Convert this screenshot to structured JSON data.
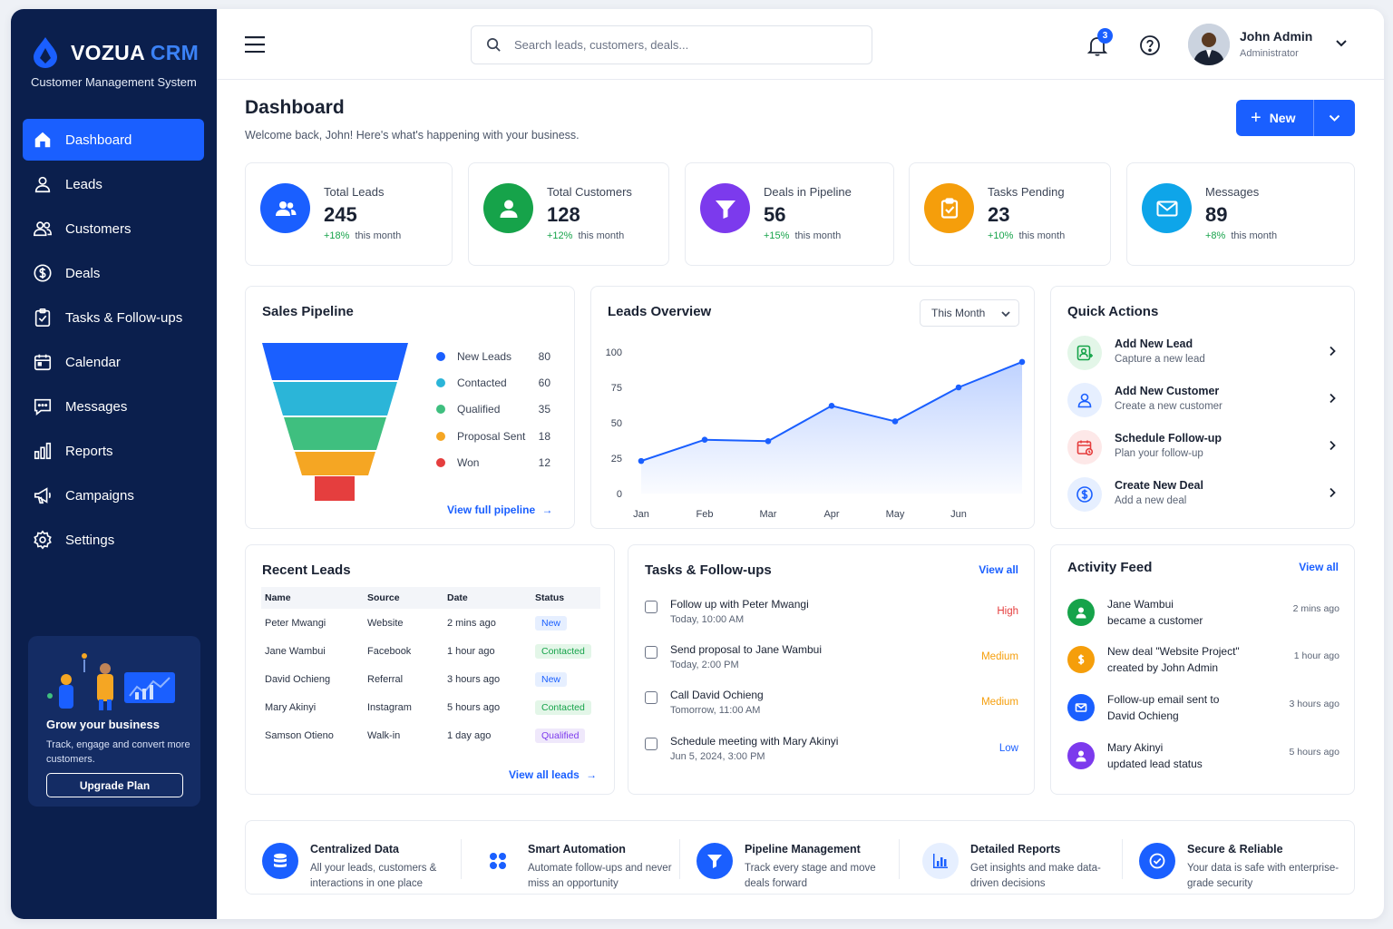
{
  "brand": {
    "name_main": "VOZUA",
    "name_accent": "CRM",
    "tagline": "Customer Management System"
  },
  "sidebar": {
    "items": [
      {
        "label": "Dashboard",
        "icon": "home-icon",
        "active": true
      },
      {
        "label": "Leads",
        "icon": "user-icon"
      },
      {
        "label": "Customers",
        "icon": "users-icon"
      },
      {
        "label": "Deals",
        "icon": "dollar-icon"
      },
      {
        "label": "Tasks & Follow-ups",
        "icon": "clipboard-check-icon"
      },
      {
        "label": "Calendar",
        "icon": "calendar-icon"
      },
      {
        "label": "Messages",
        "icon": "chat-icon"
      },
      {
        "label": "Reports",
        "icon": "bar-chart-icon"
      },
      {
        "label": "Campaigns",
        "icon": "megaphone-icon"
      },
      {
        "label": "Settings",
        "icon": "gear-icon"
      }
    ],
    "promo": {
      "title": "Grow your business",
      "text": "Track, engage and convert more customers.",
      "button": "Upgrade Plan"
    }
  },
  "header": {
    "search_placeholder": "Search leads, customers, deals...",
    "notifications": "3",
    "user_name": "John Admin",
    "user_role": "Administrator"
  },
  "page": {
    "title": "Dashboard",
    "subtitle": "Welcome back, John! Here's what's happening with your business.",
    "new_button": "New"
  },
  "stats": [
    {
      "label": "Total Leads",
      "value": "245",
      "delta": "+18%",
      "period": "this month",
      "color": "#1a5fff"
    },
    {
      "label": "Total Customers",
      "value": "128",
      "delta": "+12%",
      "period": "this month",
      "color": "#16a34a"
    },
    {
      "label": "Deals in Pipeline",
      "value": "56",
      "delta": "+15%",
      "period": "this month",
      "color": "#7c3aed"
    },
    {
      "label": "Tasks Pending",
      "value": "23",
      "delta": "+10%",
      "period": "this month",
      "color": "#f59e0b"
    },
    {
      "label": "Messages",
      "value": "89",
      "delta": "+8%",
      "period": "this month",
      "color": "#0ea5e9"
    }
  ],
  "pipeline": {
    "title": "Sales Pipeline",
    "stages": [
      {
        "label": "New Leads",
        "value": "80",
        "color": "#1a5fff"
      },
      {
        "label": "Contacted",
        "value": "60",
        "color": "#2bb5d8"
      },
      {
        "label": "Qualified",
        "value": "35",
        "color": "#3fbf7f"
      },
      {
        "label": "Proposal Sent",
        "value": "18",
        "color": "#f5a623"
      },
      {
        "label": "Won",
        "value": "12",
        "color": "#e53e3e"
      }
    ],
    "link": "View full pipeline"
  },
  "leads_overview": {
    "title": "Leads Overview",
    "period": "This Month"
  },
  "chart_data": {
    "type": "area",
    "categories": [
      "Jan",
      "Feb",
      "Mar",
      "Apr",
      "May",
      "Jun"
    ],
    "x": [
      0,
      1,
      2,
      3,
      4,
      5,
      6
    ],
    "values": [
      23,
      38,
      37,
      62,
      51,
      75,
      93
    ],
    "ylim": [
      0,
      100
    ],
    "yticks": [
      "0",
      "25",
      "50",
      "75",
      "100"
    ],
    "grid": false,
    "color": "#1a5fff"
  },
  "quick_actions": {
    "title": "Quick Actions",
    "items": [
      {
        "title": "Add New Lead",
        "sub": "Capture a new lead",
        "icon": "user-plus-icon",
        "color": "#16a34a",
        "bg": "#e3f6e8"
      },
      {
        "title": "Add New Customer",
        "sub": "Create a new customer",
        "icon": "user-icon",
        "color": "#1a5fff",
        "bg": "#e6efff"
      },
      {
        "title": "Schedule Follow-up",
        "sub": "Plan your follow-up",
        "icon": "calendar-icon",
        "color": "#e53e3e",
        "bg": "#fde8e8"
      },
      {
        "title": "Create New Deal",
        "sub": "Add a new deal",
        "icon": "dollar-icon",
        "color": "#1a5fff",
        "bg": "#e6efff"
      }
    ]
  },
  "recent_leads": {
    "title": "Recent Leads",
    "columns": [
      "Name",
      "Source",
      "Date",
      "Status"
    ],
    "rows": [
      {
        "name": "Peter Mwangi",
        "source": "Website",
        "date": "2 mins ago",
        "status": "New"
      },
      {
        "name": "Jane Wambui",
        "source": "Facebook",
        "date": "1 hour ago",
        "status": "Contacted"
      },
      {
        "name": "David Ochieng",
        "source": "Referral",
        "date": "3 hours ago",
        "status": "New"
      },
      {
        "name": "Mary Akinyi",
        "source": "Instagram",
        "date": "5 hours ago",
        "status": "Contacted"
      },
      {
        "name": "Samson Otieno",
        "source": "Walk-in",
        "date": "1 day ago",
        "status": "Qualified"
      }
    ],
    "link": "View all leads"
  },
  "tasks": {
    "title": "Tasks & Follow-ups",
    "link": "View all",
    "items": [
      {
        "title": "Follow up with Peter Mwangi",
        "when": "Today, 10:00 AM",
        "priority": "High",
        "color": "#e53e3e"
      },
      {
        "title": "Send proposal to Jane Wambui",
        "when": "Today, 2:00 PM",
        "priority": "Medium",
        "color": "#f59e0b"
      },
      {
        "title": "Call David Ochieng",
        "when": "Tomorrow, 11:00 AM",
        "priority": "Medium",
        "color": "#f59e0b"
      },
      {
        "title": "Schedule meeting with Mary Akinyi",
        "when": "Jun 5, 2024, 3:00 PM",
        "priority": "Low",
        "color": "#1a5fff"
      }
    ]
  },
  "activity": {
    "title": "Activity Feed",
    "link": "View all",
    "items": [
      {
        "line1": "Jane Wambui",
        "line2": "became a customer",
        "time": "2 mins ago",
        "icon": "user-icon",
        "color": "#16a34a"
      },
      {
        "line1": "New deal \"Website Project\"",
        "line2": "created by John Admin",
        "time": "1 hour ago",
        "icon": "dollar-icon",
        "color": "#f59e0b"
      },
      {
        "line1": "Follow-up email sent to",
        "line2": "David Ochieng",
        "time": "3 hours ago",
        "icon": "mail-icon",
        "color": "#1a5fff"
      },
      {
        "line1": "Mary Akinyi",
        "line2": "updated lead status",
        "time": "5 hours ago",
        "icon": "user-icon",
        "color": "#7c3aed"
      }
    ]
  },
  "features": [
    {
      "title": "Centralized Data",
      "desc": "All your leads, customers & interactions in one place",
      "icon": "database-icon"
    },
    {
      "title": "Smart Automation",
      "desc": "Automate follow-ups and never miss an opportunity",
      "icon": "automation-icon"
    },
    {
      "title": "Pipeline Management",
      "desc": "Track every stage and move deals forward",
      "icon": "funnel-icon"
    },
    {
      "title": "Detailed Reports",
      "desc": "Get insights and make data-driven decisions",
      "icon": "report-icon"
    },
    {
      "title": "Secure & Reliable",
      "desc": "Your data is safe with enterprise-grade security",
      "icon": "shield-check-icon"
    }
  ]
}
